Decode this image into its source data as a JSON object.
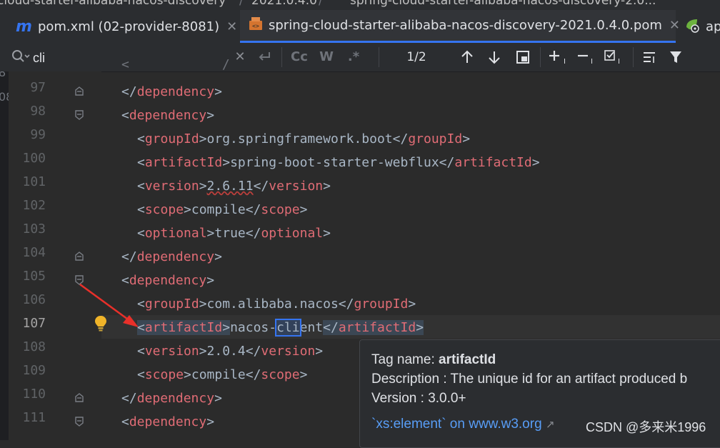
{
  "breadcrumb": {
    "part1": "cloud-starter-alibaba-nacos-discovery",
    "part2": "2021.0.4.0",
    "part3": "spring-cloud-starter-alibaba-nacos-discovery-2.0..."
  },
  "tabs": [
    {
      "label": "pom.xml (02-provider-8081)",
      "icon": "maven-icon"
    },
    {
      "label": "spring-cloud-starter-alibaba-nacos-discovery-2021.0.4.0.pom",
      "icon": "pom-file-icon",
      "active": true
    },
    {
      "label": "ap",
      "icon": "spring-boot-app-icon"
    }
  ],
  "find": {
    "query": "cli",
    "match_count": "1/2",
    "match_case": "Cc",
    "words": "W",
    "regex": ".*"
  },
  "left_strip": {
    "a": "8",
    "b": "08"
  },
  "gutter": {
    "lines": [
      "97",
      "98",
      "99",
      "100",
      "101",
      "102",
      "103",
      "104",
      "105",
      "106",
      "107",
      "108",
      "109",
      "110",
      "111"
    ],
    "current": "107"
  },
  "code": {
    "l97": {
      "close": "dependency"
    },
    "l98": {
      "open": "dependency"
    },
    "l99": {
      "tag": "groupId",
      "text": "org.springframework.boot"
    },
    "l100": {
      "tag": "artifactId",
      "text": "spring-boot-starter-webflux"
    },
    "l101": {
      "tag": "version",
      "text": "2.6.11"
    },
    "l102": {
      "tag": "scope",
      "text": "compile"
    },
    "l103": {
      "tag": "optional",
      "text": "true"
    },
    "l104": {
      "close": "dependency"
    },
    "l105": {
      "open": "dependency"
    },
    "l106": {
      "tag": "groupId",
      "text": "com.alibaba.nacos"
    },
    "l107": {
      "tag": "artifactId",
      "pre": "nacos-",
      "match": "cli",
      "post": "ent"
    },
    "l108": {
      "tag": "version",
      "text": "2.0.4"
    },
    "l109": {
      "tag": "scope",
      "text": "compile"
    },
    "l110": {
      "close": "dependency"
    },
    "l111": {
      "open": "dependency"
    }
  },
  "tooltip": {
    "tag_label": "Tag name:",
    "tag_value": "artifactId",
    "description": "Description : The unique id for an artifact produced b",
    "version": "Version : 3.0.0+",
    "link": "`xs:element` on www.w3.org",
    "link_arrow": "↗"
  },
  "watermark": "CSDN @多来米1996",
  "colors": {
    "accent": "#3574f0",
    "tag": "#e8bf6a",
    "code_text": "#a9b7c6",
    "bulb": "#f0b429",
    "arrow": "#e8302a"
  }
}
